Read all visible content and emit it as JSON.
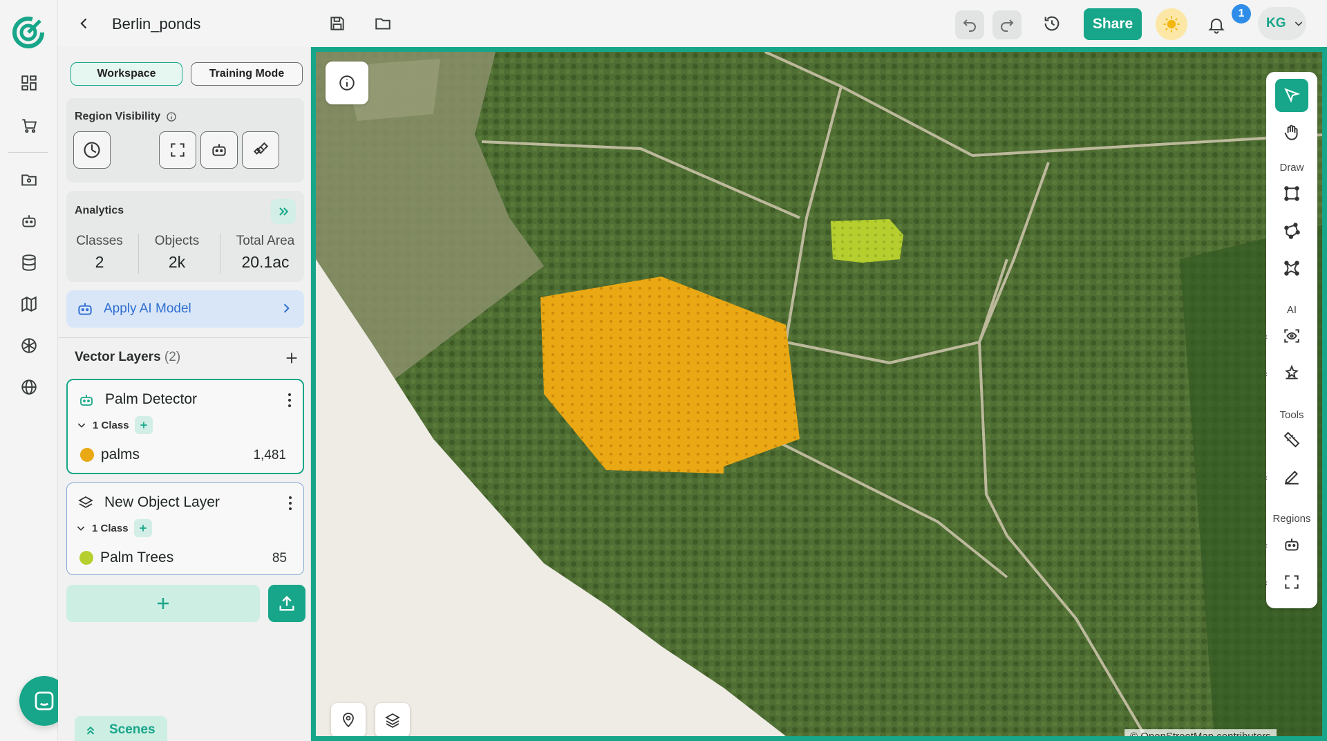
{
  "header": {
    "project_title": "Berlin_ponds",
    "share_label": "Share",
    "notification_count": "1",
    "user_initials": "KG"
  },
  "panel": {
    "modes": [
      "Workspace",
      "Training Mode"
    ],
    "region_visibility_title": "Region Visibility",
    "analytics": {
      "title": "Analytics",
      "stats": [
        {
          "label": "Classes",
          "value": "2"
        },
        {
          "label": "Objects",
          "value": "2k"
        },
        {
          "label": "Total Area",
          "value": "20.1ac"
        }
      ]
    },
    "apply_ai_label": "Apply AI Model",
    "vector_layers": {
      "title": "Vector Layers",
      "count": "(2)",
      "layers": [
        {
          "name": "Palm Detector",
          "class_count": "1 Class",
          "item": "palms",
          "item_count": "1,481",
          "color": "#e9a814"
        },
        {
          "name": "New Object Layer",
          "class_count": "1 Class",
          "item": "Palm Trees",
          "item_count": "85",
          "color": "#b6cf2e"
        }
      ]
    },
    "scenes_label": "Scenes"
  },
  "toolbar": {
    "sections": [
      "Draw",
      "AI",
      "Tools",
      "Regions"
    ]
  },
  "map": {
    "attribution": "© OpenStreetMap contributors"
  },
  "colors": {
    "accent": "#17a689",
    "palm_detector": "#e9a814",
    "palm_trees": "#b6cf2e"
  }
}
